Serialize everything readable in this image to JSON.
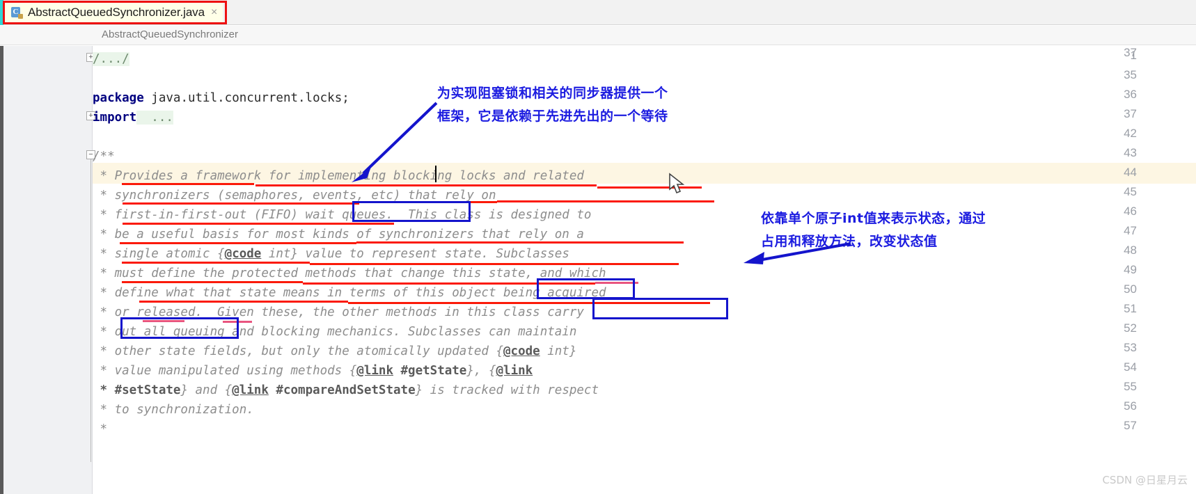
{
  "window": {
    "tab": {
      "filename": "AbstractQueuedSynchronizer.java",
      "close_label": "×",
      "icon": "java-class-file-icon",
      "icon_letter": "C"
    },
    "breadcrumb": "AbstractQueuedSynchronizer"
  },
  "editor": {
    "line_numbers": [
      "1",
      "35",
      "36",
      "37",
      "42",
      "43",
      "44",
      "45",
      "46",
      "47",
      "48",
      "49",
      "50",
      "51",
      "52",
      "53",
      "54",
      "55",
      "56",
      "57"
    ],
    "lines": [
      {
        "num": "1",
        "kind": "folded",
        "text": "/.../"
      },
      {
        "num": "35",
        "kind": "blank",
        "text": ""
      },
      {
        "num": "36",
        "kind": "code",
        "keyword": "package",
        "text": " java.util.concurrent.locks;"
      },
      {
        "num": "37",
        "kind": "import",
        "keyword": "import",
        "text": "  ..."
      },
      {
        "num": "42",
        "kind": "blank",
        "text": ""
      },
      {
        "num": "43",
        "kind": "comment",
        "text": "/**"
      },
      {
        "num": "44",
        "kind": "comment",
        "text": " * Provides a framework for implementing blocking locks and related"
      },
      {
        "num": "45",
        "kind": "comment",
        "text": " * synchronizers (semaphores, events, etc) that rely on"
      },
      {
        "num": "46",
        "kind": "comment",
        "text": " * first-in-first-out (FIFO) wait queues.  This class is designed to"
      },
      {
        "num": "47",
        "kind": "comment",
        "text": " * be a useful basis for most kinds of synchronizers that rely on a"
      },
      {
        "num": "48",
        "kind": "comment",
        "text": " * single atomic {@code int} value to represent state. Subclasses"
      },
      {
        "num": "49",
        "kind": "comment",
        "text": " * must define the protected methods that change this state, and which"
      },
      {
        "num": "50",
        "kind": "comment",
        "text": " * define what that state means in terms of this object being acquired"
      },
      {
        "num": "51",
        "kind": "comment",
        "text": " * or released.  Given these, the other methods in this class carry"
      },
      {
        "num": "52",
        "kind": "comment",
        "text": " * out all queuing and blocking mechanics. Subclasses can maintain"
      },
      {
        "num": "53",
        "kind": "comment",
        "text": " * other state fields, but only the atomically updated {@code int}"
      },
      {
        "num": "54",
        "kind": "comment",
        "text": " * value manipulated using methods {@link #getState}, {@link"
      },
      {
        "num": "55",
        "kind": "comment",
        "text": " * #setState} and {@link #compareAndSetState} is tracked with respect"
      },
      {
        "num": "56",
        "kind": "comment",
        "text": " * to synchronization."
      },
      {
        "num": "57",
        "kind": "comment",
        "text": " *"
      }
    ],
    "highlighted_line": "44"
  },
  "annotations": {
    "note_top": {
      "line1": "为实现阻塞锁和相关的同步器提供一个",
      "line2": "框架，它是依赖于先进先出的一个等待"
    },
    "note_right": {
      "line1_a": "依靠单个原子",
      "line1_b": "int",
      "line1_c": "值来表示状态，通过",
      "line2": "占用和释放方法，改变状态值"
    },
    "colors": {
      "red_underline": "#fb1a09",
      "blue_box": "#1414cc",
      "blue_text": "#1c1ce0",
      "pink_underline": "#e8557f",
      "tab_highlight_box": "#ee1111"
    },
    "boxed_phrases": [
      "wait queues.",
      "this state,",
      "being acquired",
      "or released."
    ]
  },
  "watermark": "CSDN @日星月云"
}
